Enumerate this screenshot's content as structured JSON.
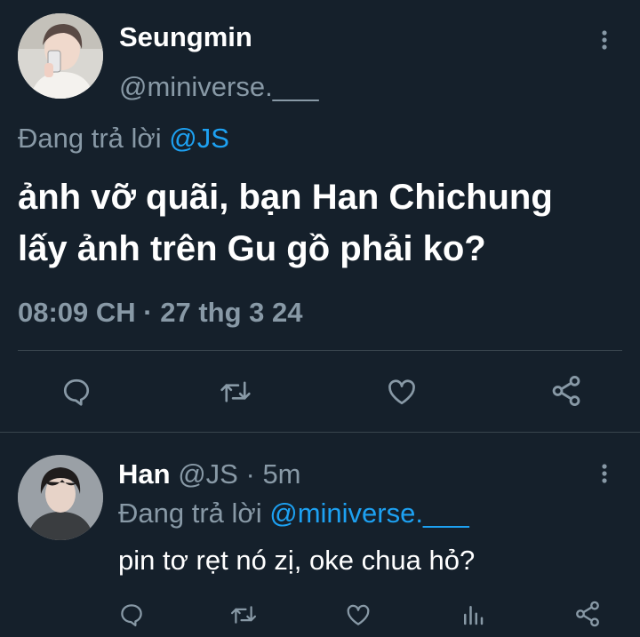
{
  "main_tweet": {
    "display_name": "Seungmin",
    "handle": "@miniverse.___",
    "replying_prefix": "Đang trả lời",
    "replying_to": "@JS",
    "text_line1": "ảnh vỡ quãi, bạn Han Chichung",
    "text_line2": "lấy ảnh trên Gu gồ phải ko?",
    "timestamp": "08:09 CH · 27 thg 3 24",
    "actions": [
      "reply-icon",
      "retweet-icon",
      "like-icon",
      "share-icon"
    ]
  },
  "reply_tweet": {
    "display_name": "Han",
    "handle": "@JS",
    "separator": "·",
    "time": "5m",
    "replying_prefix": "Đang trả lời",
    "replying_to": "@miniverse.___",
    "text": "pin tơ rẹt nó zị, oke chua hỏ?",
    "actions": [
      "reply-icon",
      "retweet-icon",
      "like-icon",
      "analytics-icon",
      "share-icon"
    ]
  },
  "colors": {
    "background": "#15202b",
    "muted": "#8899a6",
    "link": "#1da1f2",
    "divider": "#38444d"
  }
}
